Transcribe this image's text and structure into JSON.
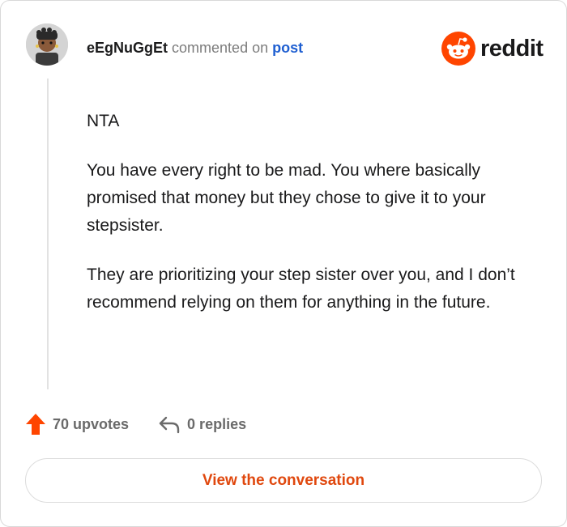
{
  "comment": {
    "username": "eEgNuGgEt",
    "action_text": "commented on",
    "post_link": "post",
    "paragraphs": [
      "NTA",
      "You have every right to be mad. You where basically promised that money but they chose to give it to your stepsister.",
      "They are prioritizing your step sister over you, and I don’t recommend relying on them for anything in the future."
    ]
  },
  "brand": {
    "name": "reddit",
    "accent_color": "#ff4500"
  },
  "actions": {
    "upvotes": "70 upvotes",
    "replies": "0 replies"
  },
  "footer": {
    "button_label": "View the conversation"
  },
  "icons": [
    "avatar",
    "reddit-logo-icon",
    "upvote-arrow-icon",
    "reply-arrow-icon"
  ]
}
